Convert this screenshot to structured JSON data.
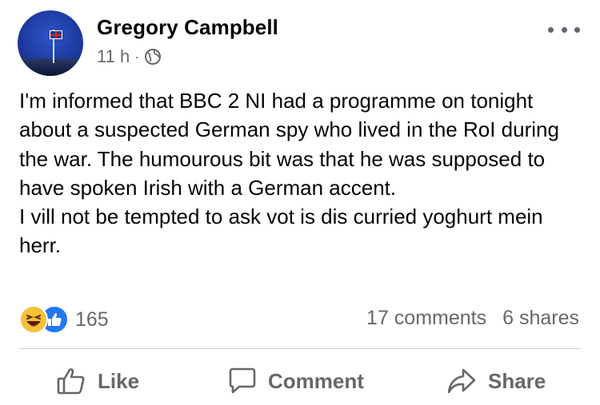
{
  "post": {
    "author": "Gregory Campbell",
    "time": "11 h",
    "separator": "·",
    "paragraphs": [
      "I'm informed that BBC 2 NI had a programme on tonight about a suspected German spy who lived in the RoI during the war. The humourous bit was that he was supposed to have spoken Irish with a German accent.",
      "I vill not be tempted to ask vot is dis curried yoghurt mein herr."
    ]
  },
  "reactions": {
    "count": "165",
    "types": [
      "haha-icon",
      "like-icon"
    ],
    "colors": {
      "haha": "#f7c13a",
      "like": "#2078f4"
    }
  },
  "stats": {
    "comments": "17 comments",
    "shares": "6 shares"
  },
  "actions": {
    "like": "Like",
    "comment": "Comment",
    "share": "Share"
  },
  "icons": {
    "privacy": "globe-icon",
    "menu": "more-icon"
  }
}
